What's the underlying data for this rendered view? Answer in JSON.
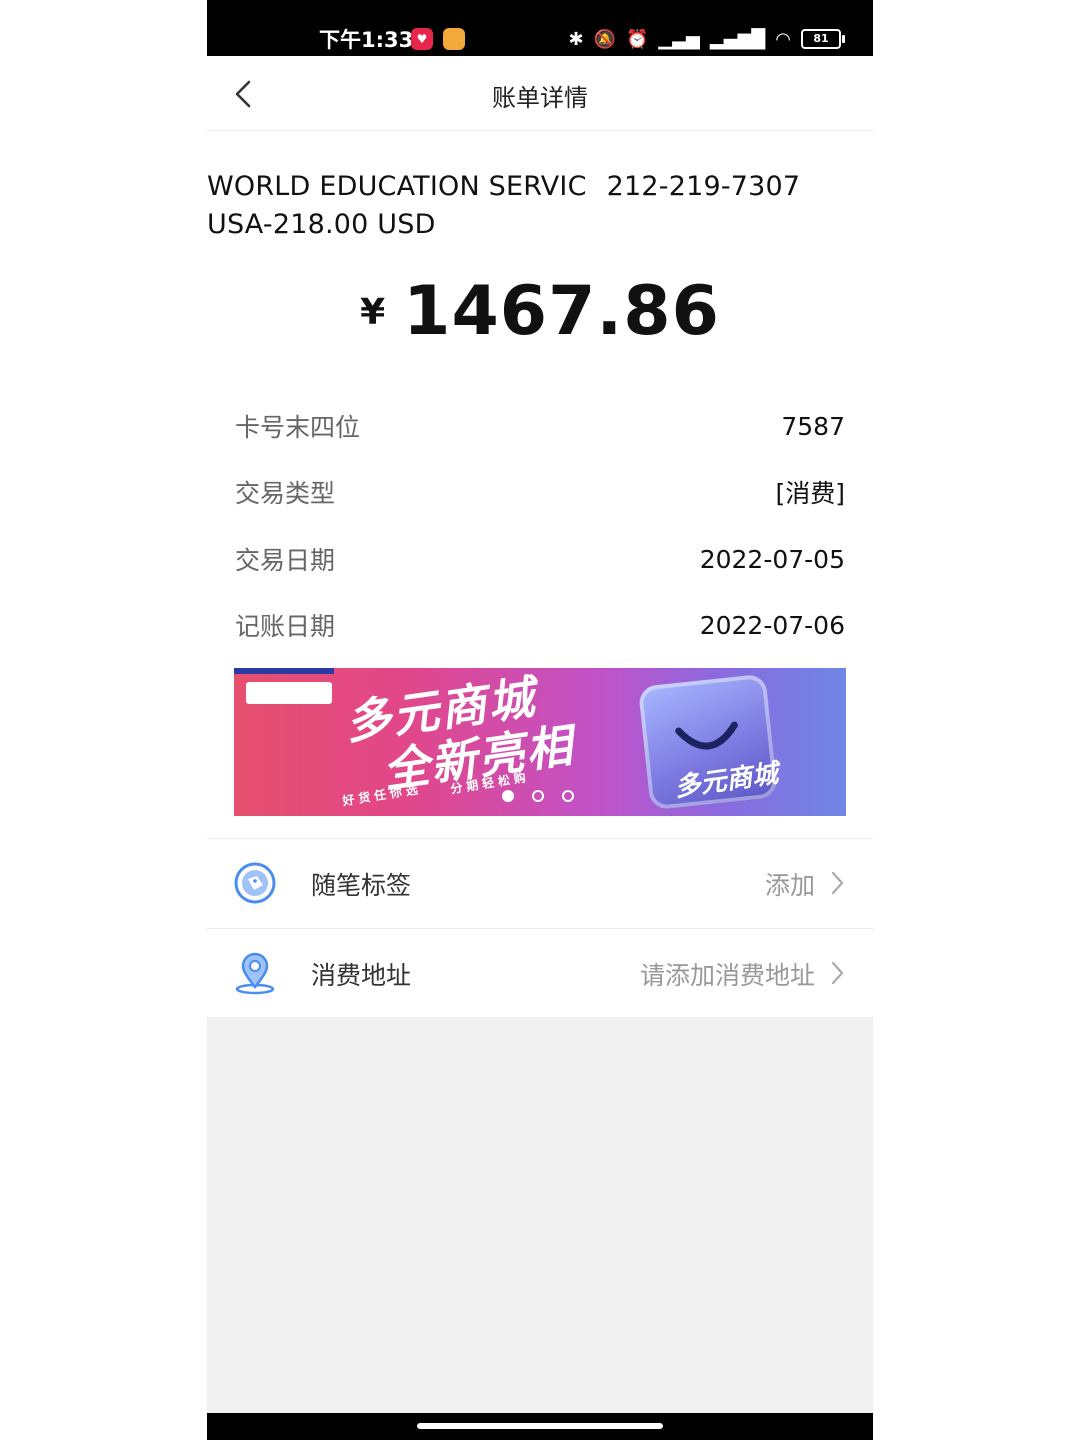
{
  "status_bar": {
    "time": "下午1:33",
    "battery": "81",
    "icons": [
      "bluetooth-icon",
      "mute-icon",
      "alarm-icon",
      "signal-icon",
      "hd-signal-icon",
      "wifi-icon",
      "battery-icon"
    ]
  },
  "header": {
    "title": "账单详情",
    "back_icon": "chevron-left-icon"
  },
  "merchant": {
    "name": "WORLD EDUCATION SERVIC",
    "phone": "212-219-7307",
    "line2": "USA-218.00 USD"
  },
  "amount": {
    "currency": "¥",
    "value": "1467.86"
  },
  "details": [
    {
      "label": "卡号末四位",
      "value": "7587"
    },
    {
      "label": "交易类型",
      "value": "[消费]"
    },
    {
      "label": "交易日期",
      "value": "2022-07-05"
    },
    {
      "label": "记账日期",
      "value": "2022-07-06"
    }
  ],
  "banner": {
    "title_line1": "多元商城",
    "title_line2": "全新亮相",
    "sub1": "好货任你选",
    "sub2": "分期轻松购",
    "bag_label": "多元商城",
    "slides": 3,
    "active_slide": 1
  },
  "list": [
    {
      "label": "随笔标签",
      "value": "添加",
      "icon": "tag-icon"
    },
    {
      "label": "消费地址",
      "value": "请添加消费地址",
      "icon": "location-pin-icon"
    }
  ],
  "colors": {
    "accent_blue": "#4a8df0",
    "text_primary": "#111111",
    "text_secondary": "#666666",
    "text_hint": "#999999",
    "background_gray": "#f0f0f0"
  }
}
